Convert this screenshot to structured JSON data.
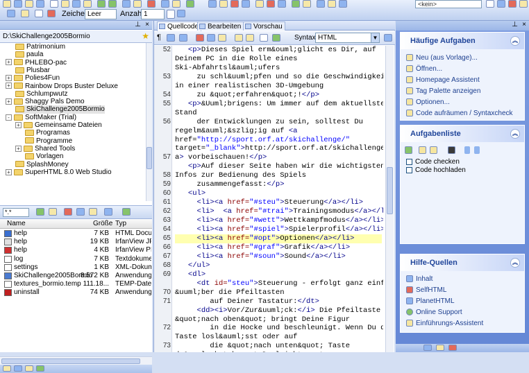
{
  "toolbar": {
    "chars_label": "Zeichen:",
    "chars_value": "Leer",
    "count_label": "Anzahl:",
    "count_value": "1",
    "keine_value": "<kein>"
  },
  "left": {
    "path": "D:\\SkiChallenge2005Bormio",
    "tree": [
      {
        "label": "Patrimonium",
        "indent": 1,
        "expander": ""
      },
      {
        "label": "paula",
        "indent": 1,
        "expander": ""
      },
      {
        "label": "PHLEBO-pac",
        "indent": 1,
        "expander": "+"
      },
      {
        "label": "Plusbar",
        "indent": 1,
        "expander": ""
      },
      {
        "label": "Polies4Fun",
        "indent": 1,
        "expander": "+"
      },
      {
        "label": "Rainbow Drops Buster Deluxe",
        "indent": 1,
        "expander": "+"
      },
      {
        "label": "Schlumpwutz",
        "indent": 1,
        "expander": ""
      },
      {
        "label": "Shaggy Pals Demo",
        "indent": 1,
        "expander": "+"
      },
      {
        "label": "SkiChallenge2005Bormio",
        "indent": 1,
        "expander": "",
        "selected": true
      },
      {
        "label": "SoftMaker (Trial)",
        "indent": 1,
        "expander": "-"
      },
      {
        "label": "Gemeinsame Dateien",
        "indent": 2,
        "expander": "+"
      },
      {
        "label": "Programas",
        "indent": 2,
        "expander": ""
      },
      {
        "label": "Programme",
        "indent": 2,
        "expander": ""
      },
      {
        "label": "Shared Tools",
        "indent": 2,
        "expander": "+"
      },
      {
        "label": "Vorlagen",
        "indent": 2,
        "expander": ""
      },
      {
        "label": "SplashMoney",
        "indent": 1,
        "expander": ""
      },
      {
        "label": "SuperHTML 8.0 Web Studio",
        "indent": 1,
        "expander": "+"
      }
    ],
    "filter": "*.*",
    "columns": {
      "name": "Name",
      "size": "Größe",
      "type": "Typ"
    },
    "files": [
      {
        "name": "help",
        "size": "7 KB",
        "type": "HTML Documen",
        "icon_color": "#3a6fd0"
      },
      {
        "name": "help",
        "size": "19 KB",
        "type": "IrfanView JPG I",
        "icon_color": "#e0e0e0"
      },
      {
        "name": "help",
        "size": "4 KB",
        "type": "IrfanView PNG",
        "icon_color": "#d03030"
      },
      {
        "name": "log",
        "size": "7 KB",
        "type": "Textdokument",
        "icon_color": "#ffffff"
      },
      {
        "name": "settings",
        "size": "1 KB",
        "type": "XML-Dokument",
        "icon_color": "#ffffff"
      },
      {
        "name": "SkiChallenge2005Bormio",
        "size": "8.572 KB",
        "type": "Anwendung",
        "icon_color": "#4a7ad0"
      },
      {
        "name": "textures_bormio.temp",
        "size": "111.18...",
        "type": "TEMP-Datei",
        "icon_color": "#ffffff"
      },
      {
        "name": "uninstall",
        "size": "74 KB",
        "type": "Anwendung",
        "icon_color": "#c02020"
      }
    ]
  },
  "editor": {
    "tabs": [
      {
        "label": "Quellcode",
        "active": true
      },
      {
        "label": "Bearbeiten",
        "active": false
      },
      {
        "label": "Vorschau",
        "active": false
      }
    ],
    "syntax_label": "Syntax:",
    "syntax_value": "HTML",
    "line_numbers": [
      {
        "n": "52",
        "row": 0
      },
      {
        "n": "53",
        "row": 3
      },
      {
        "n": "54",
        "row": 5
      },
      {
        "n": "55",
        "row": 6
      },
      {
        "n": "56",
        "row": 8
      },
      {
        "n": "57",
        "row": 12
      },
      {
        "n": "58",
        "row": 14
      },
      {
        "n": "59",
        "row": 15
      },
      {
        "n": "60",
        "row": 16
      },
      {
        "n": "61",
        "row": 17
      },
      {
        "n": "62",
        "row": 18
      },
      {
        "n": "63",
        "row": 19
      },
      {
        "n": "64",
        "row": 20
      },
      {
        "n": "65",
        "row": 21
      },
      {
        "n": "66",
        "row": 22
      },
      {
        "n": "67",
        "row": 23
      },
      {
        "n": "68",
        "row": 24
      },
      {
        "n": "69",
        "row": 25
      },
      {
        "n": "70",
        "row": 27
      },
      {
        "n": "71",
        "row": 28
      },
      {
        "n": "72",
        "row": 31
      },
      {
        "n": "73",
        "row": 33
      }
    ],
    "lines": [
      "   <p>Dieses Spiel erm&ouml;glicht es Dir, auf",
      "Deinem PC in die Rolle eines",
      "Ski-Abfahrtsl&auml;ufers",
      "     zu schl&uuml;pfen und so die Geschwindigkeit",
      "in einer realistischen 3D-Umgebung",
      "     zu &quot;erfahren&quot;!</p>",
      "   <p>&Uuml;brigens: Um immer auf dem aktuellsten",
      "Stand",
      "     der Entwicklungen zu sein, solltest Du",
      "regelm&auml;&szlig;ig auf <a",
      "href=\"http://sport.orf.at/skichallenge/\"",
      "target=\"_blank\">http://sport.orf.at/skichallenge/</",
      "a> vorbeischauen!</p>",
      "   <p>Auf dieser Seite haben wir die wichtigsten",
      "Infos zur Bedienung des Spiels",
      "     zusammengefasst:</p>",
      "   <ul>",
      "     <li><a href=\"#steu\">Steuerung</a></li>",
      "     <li>  <a href=\"#trai\">Trainingsmodus</a></li>",
      "     <li><a href=\"#wett\">Wettkampfmodus</a></li>",
      "     <li><a href=\"#spiel\">Spielerprofil</a></li>",
      "     <li><a href=\"#opt\">Optionen</a></li>",
      "     <li><a href=\"#graf\">Grafik</a></li>",
      "     <li><a href=\"#soun\">Sound</a></li>",
      "   </ul>",
      "   <dl>",
      "     <dt id=\"steu\">Steuerung - erfolgt ganz einfach",
      "&uuml;ber die Pfeiltasten",
      "        auf Deiner Tastatur:</dt>",
      "     <dd><i>Vor/Zur&uuml;ck:</i> Die Pfeiltaste",
      "&quot;nach oben&quot; bringt Deine Figur",
      "        in die Hocke und beschleunigt. Wenn Du die",
      "Taste losl&auml;sst oder auf",
      "        die &quot;nach unten&quot; Taste",
      "dr&uuml;ckst kannst Du leichter steuern,"
    ],
    "highlight_row": 21
  },
  "right": {
    "common_tasks": {
      "title": "Häufige Aufgaben",
      "items": [
        "Neu (aus Vorlage)...",
        "Öffnen...",
        "Homepage Assistent",
        "Tag Palette anzeigen",
        "Optionen...",
        "Code aufräumen / Syntaxcheck"
      ]
    },
    "task_list": {
      "title": "Aufgabenliste",
      "checks": [
        "Code checken",
        "Code hochladen"
      ]
    },
    "help_sources": {
      "title": "Hilfe-Quellen",
      "items": [
        "Inhalt",
        "SelfHTML",
        "PlanetHTML",
        "Online Support",
        "Einführungs-Assistent"
      ]
    }
  }
}
